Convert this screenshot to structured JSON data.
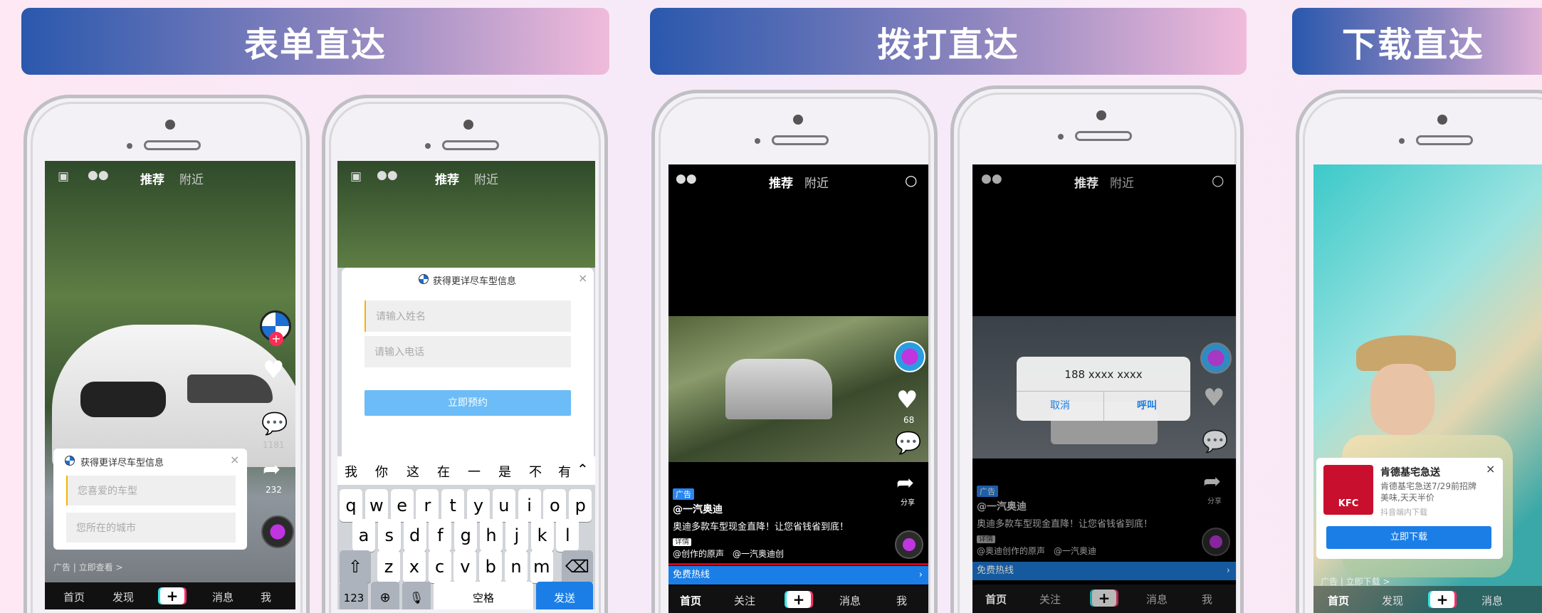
{
  "sections": [
    {
      "title": "表单直达"
    },
    {
      "title": "拨打直达"
    },
    {
      "title": "下载直达"
    }
  ],
  "top_nav": {
    "recommend": "推荐",
    "nearby": "附近"
  },
  "bottom_nav": {
    "home": "首页",
    "discover": "发现",
    "follow": "关注",
    "messages": "消息",
    "me": "我",
    "plus": "+"
  },
  "form_phone": {
    "card_title": "获得更详尽车型信息",
    "field_car": "您喜爱的车型",
    "field_city": "您所在的城市",
    "ad_line": "广告 | 立即查看 >",
    "share_count": "232",
    "comment_count": "1181"
  },
  "keyboard_phone": {
    "card_title": "获得更详尽车型信息",
    "name_placeholder": "请输入姓名",
    "phone_placeholder": "请输入电话",
    "submit": "立即预约",
    "candidates": [
      "我",
      "你",
      "这",
      "在",
      "一",
      "是",
      "不",
      "有"
    ],
    "row1": [
      "q",
      "w",
      "e",
      "r",
      "t",
      "y",
      "u",
      "i",
      "o",
      "p"
    ],
    "row2": [
      "a",
      "s",
      "d",
      "f",
      "g",
      "h",
      "j",
      "k",
      "l"
    ],
    "row3": [
      "z",
      "x",
      "c",
      "v",
      "b",
      "n",
      "m"
    ],
    "num_key": "123",
    "space": "空格",
    "send": "发送"
  },
  "call_phone": {
    "like_count": "68",
    "share": "分享",
    "ad_badge": "广告",
    "account": "@一汽奥迪",
    "desc": "奥迪多款车型现金直降！让您省钱省到底！",
    "detail": "详情",
    "music": "@创作的原声　@一汽奥迪创",
    "hotline": "免费热线"
  },
  "dial_phone": {
    "number": "188 xxxx xxxx",
    "cancel": "取消",
    "call": "呼叫",
    "ad_badge": "广告",
    "account": "@一汽奥迪",
    "desc": "奥迪多款车型现金直降！让您省钱省到底！",
    "detail": "详情",
    "music": "@奥迪创作的原声　@一汽奥迪",
    "hotline": "免费热线",
    "share": "分享"
  },
  "download_phone": {
    "app_name": "肯德基宅急送",
    "app_desc": "肯德基宅急送7/29前招牌美味,天天半价",
    "source": "抖音端内下载",
    "download": "立即下载",
    "ad_line": "广告 | 立即下载 >",
    "logo_text": "KFC"
  },
  "colors": {
    "accent_blue": "#1b7ee6",
    "submit_blue": "#6bbcf7",
    "banner_start": "#2a58ad",
    "banner_end": "#f0bbdb"
  }
}
